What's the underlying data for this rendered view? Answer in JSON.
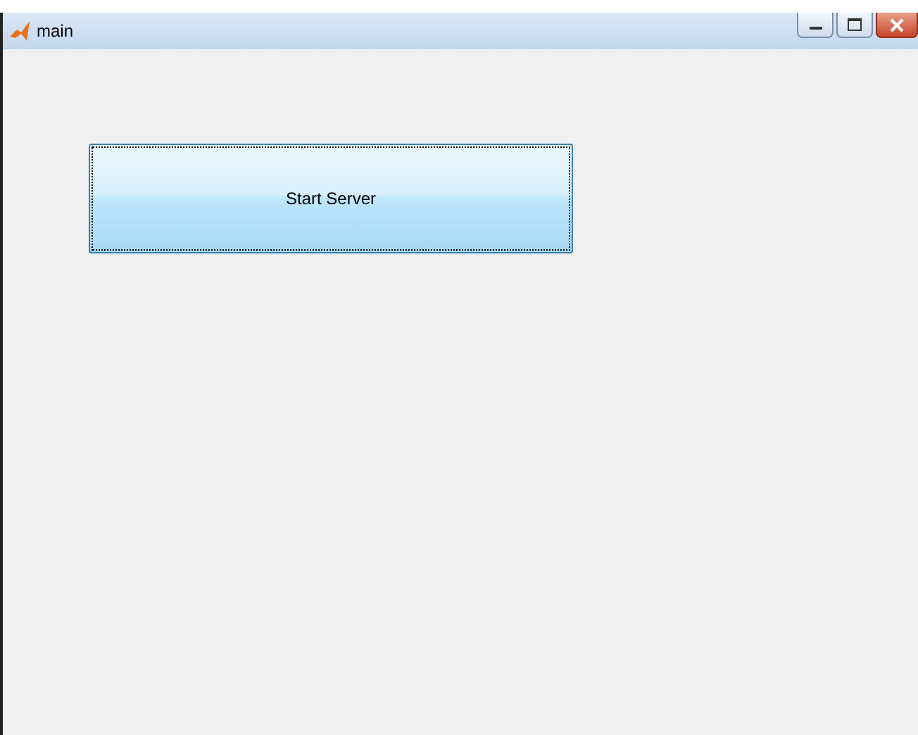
{
  "window": {
    "title": "main"
  },
  "button": {
    "label": "Start Server",
    "focused": true
  }
}
